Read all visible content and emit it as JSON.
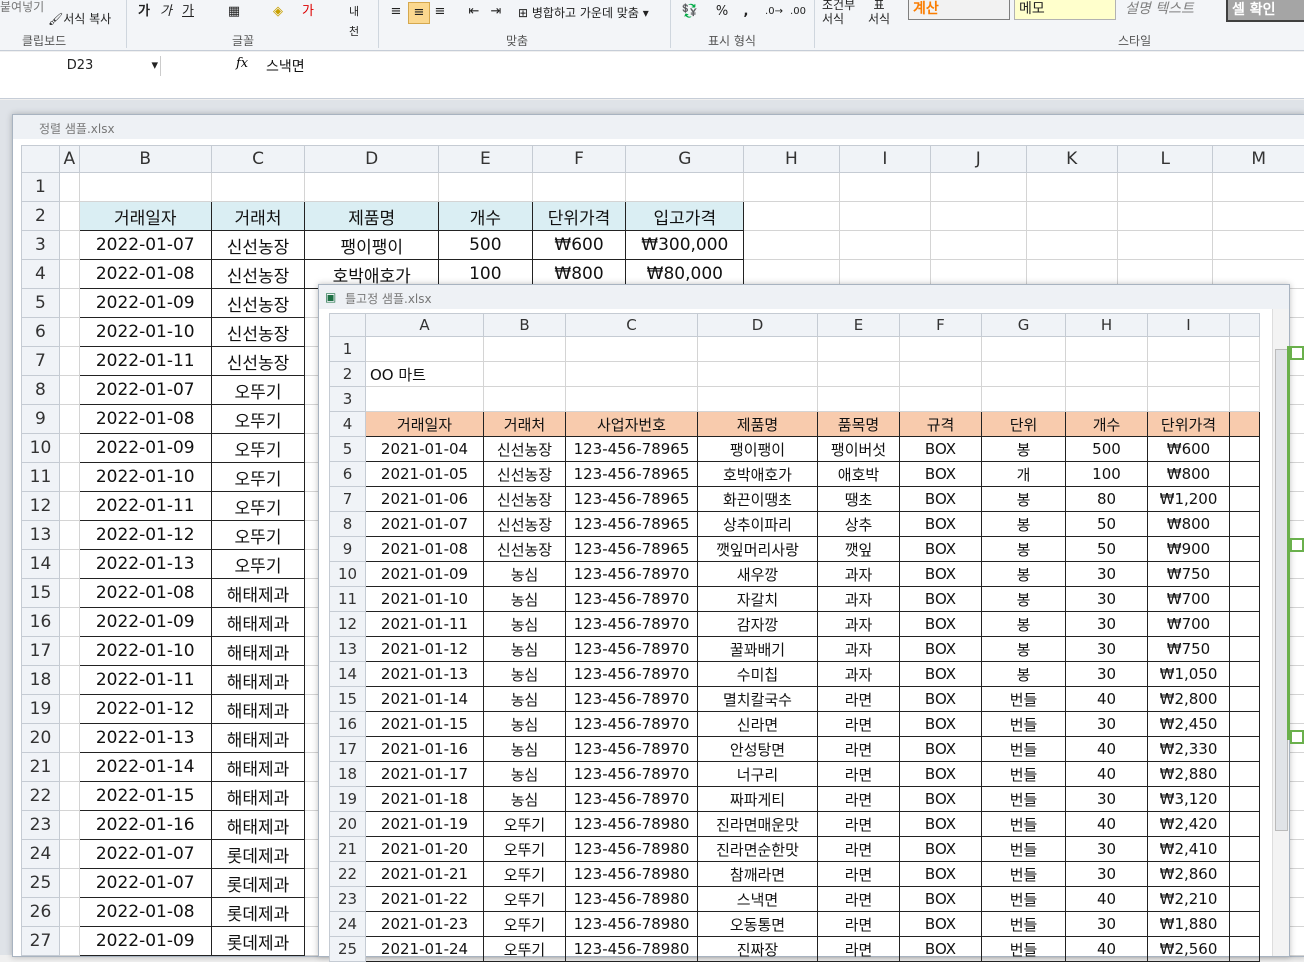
{
  "ribbon": {
    "paste_label": "붙여넣기",
    "format_copy_label": "서식 복사",
    "group_clipboard": "클립보드",
    "group_font": "글꼴",
    "group_align": "맞춤",
    "group_number": "표시 형식",
    "group_style": "스타일",
    "font_btns": [
      "가",
      "가",
      "가"
    ],
    "merge_label": "병합하고 가운데 맞춤",
    "percent": "%",
    "comma": ",",
    "cond_format": "조건부\n서식",
    "table_format": "표\n서식",
    "style_calc": "계산",
    "style_memo": "메모",
    "style_desc": "설명 텍스트",
    "style_check": "셀 확인"
  },
  "formula": {
    "namebox": "D23",
    "fx": "fx",
    "value": "스낵면"
  },
  "win1": {
    "title": "정렬 샘플.xlsx",
    "columns": [
      "A",
      "B",
      "C",
      "D",
      "E",
      "F",
      "G",
      "H",
      "I",
      "J",
      "K",
      "L",
      "M"
    ],
    "header_row": [
      "거래일자",
      "거래처",
      "제품명",
      "개수",
      "단위가격",
      "입고가격"
    ],
    "rows": [
      [
        "2022-01-07",
        "신선농장",
        "팽이팽이",
        "500",
        "₩600",
        "₩300,000"
      ],
      [
        "2022-01-08",
        "신선농장",
        "호박애호가",
        "100",
        "₩800",
        "₩80,000"
      ],
      [
        "2022-01-09",
        "신선농장"
      ],
      [
        "2022-01-10",
        "신선농장"
      ],
      [
        "2022-01-11",
        "신선농장"
      ],
      [
        "2022-01-07",
        "오뚜기"
      ],
      [
        "2022-01-08",
        "오뚜기"
      ],
      [
        "2022-01-09",
        "오뚜기"
      ],
      [
        "2022-01-10",
        "오뚜기"
      ],
      [
        "2022-01-11",
        "오뚜기"
      ],
      [
        "2022-01-12",
        "오뚜기"
      ],
      [
        "2022-01-13",
        "오뚜기"
      ],
      [
        "2022-01-08",
        "해태제과"
      ],
      [
        "2022-01-09",
        "해태제과"
      ],
      [
        "2022-01-10",
        "해태제과"
      ],
      [
        "2022-01-11",
        "해태제과"
      ],
      [
        "2022-01-12",
        "해태제과"
      ],
      [
        "2022-01-13",
        "해태제과"
      ],
      [
        "2022-01-14",
        "해태제과"
      ],
      [
        "2022-01-15",
        "해태제과"
      ],
      [
        "2022-01-16",
        "해태제과"
      ],
      [
        "2022-01-07",
        "롯데제과"
      ],
      [
        "2022-01-07",
        "롯데제과"
      ],
      [
        "2022-01-08",
        "롯데제과"
      ],
      [
        "2022-01-09",
        "롯데제과"
      ]
    ]
  },
  "win2": {
    "title": "틀고정 샘플.xlsx",
    "columns": [
      "A",
      "B",
      "C",
      "D",
      "E",
      "F",
      "G",
      "H",
      "I"
    ],
    "store_name": "OO 마트",
    "header_row": [
      "거래일자",
      "거래처",
      "사업자번호",
      "제품명",
      "품목명",
      "규격",
      "단위",
      "개수",
      "단위가격"
    ],
    "rows": [
      [
        "2021-01-04",
        "신선농장",
        "123-456-78965",
        "팽이팽이",
        "팽이버섯",
        "BOX",
        "봉",
        "500",
        "₩600"
      ],
      [
        "2021-01-05",
        "신선농장",
        "123-456-78965",
        "호박애호가",
        "애호박",
        "BOX",
        "개",
        "100",
        "₩800"
      ],
      [
        "2021-01-06",
        "신선농장",
        "123-456-78965",
        "화끈이땡초",
        "땡초",
        "BOX",
        "봉",
        "80",
        "₩1,200"
      ],
      [
        "2021-01-07",
        "신선농장",
        "123-456-78965",
        "상추이파리",
        "상추",
        "BOX",
        "봉",
        "50",
        "₩800"
      ],
      [
        "2021-01-08",
        "신선농장",
        "123-456-78965",
        "깻잎머리사랑",
        "깻잎",
        "BOX",
        "봉",
        "50",
        "₩900"
      ],
      [
        "2021-01-09",
        "농심",
        "123-456-78970",
        "새우깡",
        "과자",
        "BOX",
        "봉",
        "30",
        "₩750"
      ],
      [
        "2021-01-10",
        "농심",
        "123-456-78970",
        "자갈치",
        "과자",
        "BOX",
        "봉",
        "30",
        "₩700"
      ],
      [
        "2021-01-11",
        "농심",
        "123-456-78970",
        "감자깡",
        "과자",
        "BOX",
        "봉",
        "30",
        "₩700"
      ],
      [
        "2021-01-12",
        "농심",
        "123-456-78970",
        "꿀꽈배기",
        "과자",
        "BOX",
        "봉",
        "30",
        "₩750"
      ],
      [
        "2021-01-13",
        "농심",
        "123-456-78970",
        "수미칩",
        "과자",
        "BOX",
        "봉",
        "30",
        "₩1,050"
      ],
      [
        "2021-01-14",
        "농심",
        "123-456-78970",
        "멸치칼국수",
        "라면",
        "BOX",
        "번들",
        "40",
        "₩2,800"
      ],
      [
        "2021-01-15",
        "농심",
        "123-456-78970",
        "신라면",
        "라면",
        "BOX",
        "번들",
        "30",
        "₩2,450"
      ],
      [
        "2021-01-16",
        "농심",
        "123-456-78970",
        "안성탕면",
        "라면",
        "BOX",
        "번들",
        "40",
        "₩2,330"
      ],
      [
        "2021-01-17",
        "농심",
        "123-456-78970",
        "너구리",
        "라면",
        "BOX",
        "번들",
        "40",
        "₩2,880"
      ],
      [
        "2021-01-18",
        "농심",
        "123-456-78970",
        "짜파게티",
        "라면",
        "BOX",
        "번들",
        "30",
        "₩3,120"
      ],
      [
        "2021-01-19",
        "오뚜기",
        "123-456-78980",
        "진라면매운맛",
        "라면",
        "BOX",
        "번들",
        "40",
        "₩2,420"
      ],
      [
        "2021-01-20",
        "오뚜기",
        "123-456-78980",
        "진라면순한맛",
        "라면",
        "BOX",
        "번들",
        "30",
        "₩2,410"
      ],
      [
        "2021-01-21",
        "오뚜기",
        "123-456-78980",
        "참깨라면",
        "라면",
        "BOX",
        "번들",
        "30",
        "₩2,860"
      ],
      [
        "2021-01-22",
        "오뚜기",
        "123-456-78980",
        "스낵면",
        "라면",
        "BOX",
        "번들",
        "40",
        "₩2,210"
      ],
      [
        "2021-01-23",
        "오뚜기",
        "123-456-78980",
        "오동통면",
        "라면",
        "BOX",
        "번들",
        "30",
        "₩1,880"
      ],
      [
        "2021-01-24",
        "오뚜기",
        "123-456-78980",
        "진짜장",
        "라면",
        "BOX",
        "번들",
        "40",
        "₩2,560"
      ]
    ]
  }
}
